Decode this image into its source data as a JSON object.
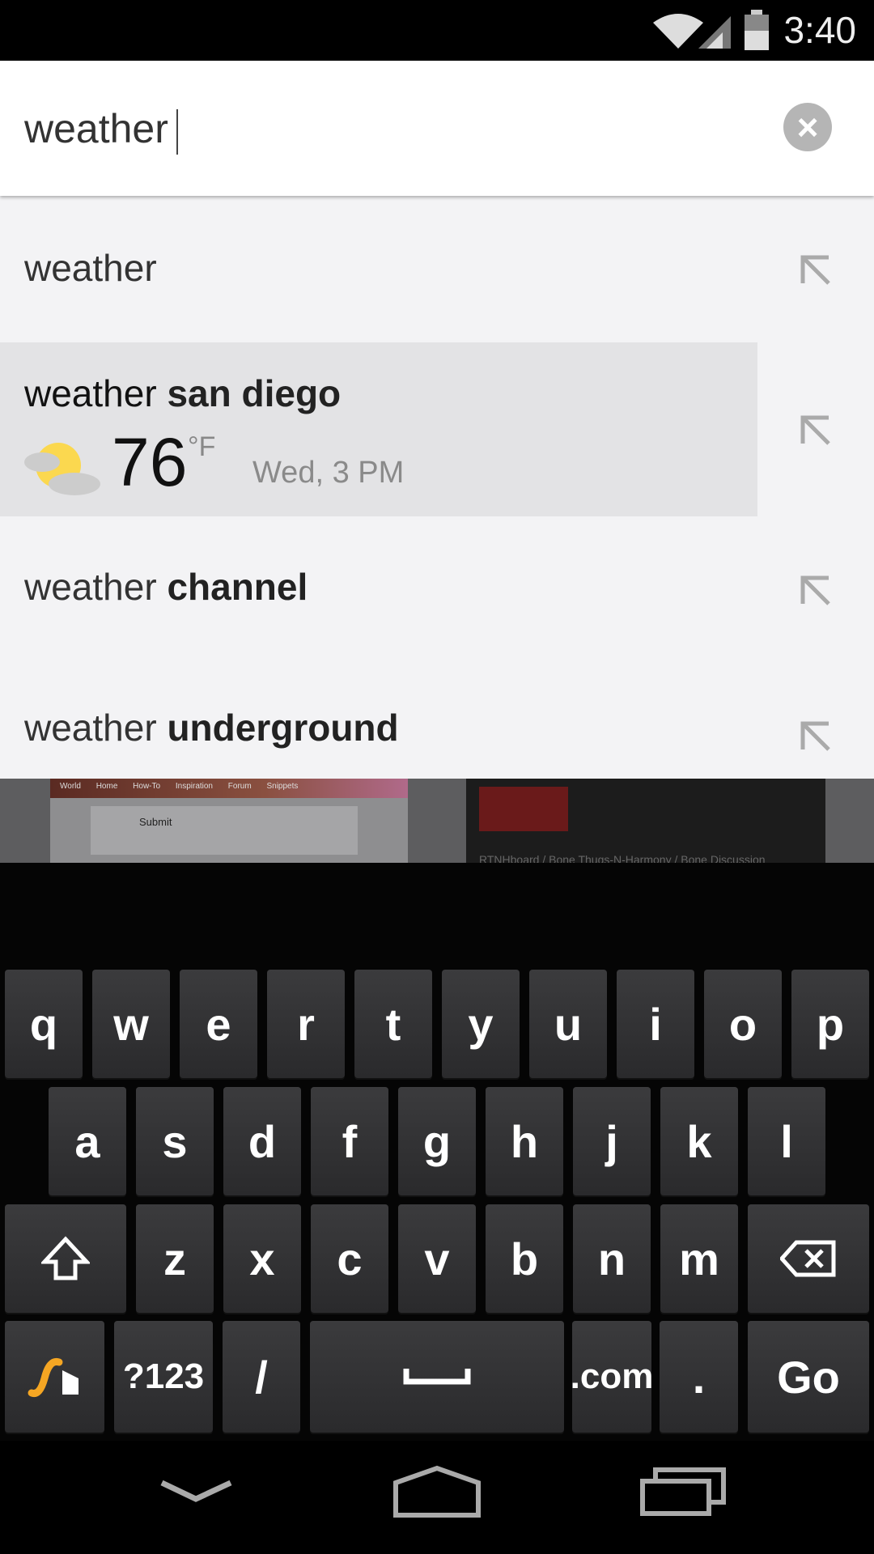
{
  "status_bar": {
    "time": "3:40",
    "icons": [
      "wifi-icon",
      "signal-icon",
      "battery-icon"
    ]
  },
  "search": {
    "query": "weather",
    "clear_icon": "close-icon"
  },
  "suggestions": [
    {
      "prefix": "weather",
      "bold": ""
    },
    {
      "prefix": "weather ",
      "bold": "san diego",
      "weather": {
        "temperature": "76",
        "unit": "°F",
        "time": "Wed, 3 PM",
        "icon": "partly-cloudy-icon"
      }
    },
    {
      "prefix": "weather ",
      "bold": "channel"
    },
    {
      "prefix": "weather ",
      "bold": "underground"
    }
  ],
  "background_tabs": [
    {
      "nav": [
        "World Home",
        "How-To",
        "Inspiration",
        "Forum",
        "Snippets"
      ],
      "submit": "Submit"
    },
    {
      "title": "RTNHboard / Bone Thugs-N-Harmony / Bone Discussion"
    }
  ],
  "keyboard": {
    "row1": [
      "q",
      "w",
      "e",
      "r",
      "t",
      "y",
      "u",
      "i",
      "o",
      "p"
    ],
    "row2": [
      "a",
      "s",
      "d",
      "f",
      "g",
      "h",
      "j",
      "k",
      "l"
    ],
    "row3": [
      "z",
      "x",
      "c",
      "v",
      "b",
      "n",
      "m"
    ],
    "symbols": "?123",
    "slash": "/",
    "dotcom": ".com",
    "period": ".",
    "go": "Go"
  },
  "colors": {
    "highlight": "#e3e3e5",
    "suggestion_bg": "#f3f3f5",
    "swype_accent": "#f5a623"
  }
}
